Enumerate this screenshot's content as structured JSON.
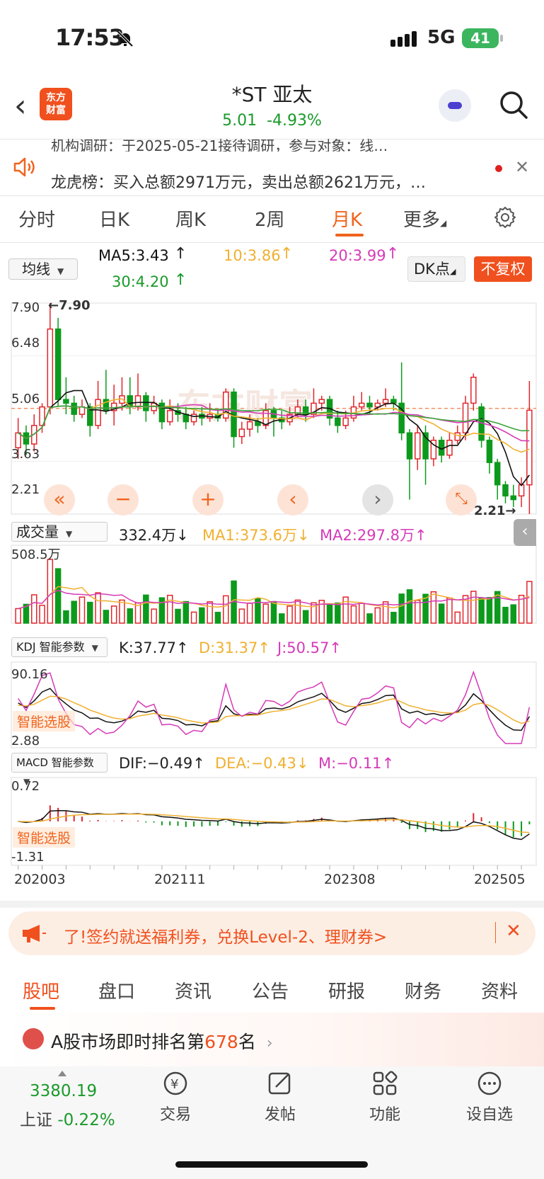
{
  "status_bar": {
    "time": "17:53",
    "network": "5G",
    "battery": "41"
  },
  "header": {
    "back_icon": "chevron-left-icon",
    "logo_line1": "东方",
    "logo_line2": "财富",
    "stock_name": "*ST 亚太",
    "price": "5.01",
    "change_pct": "-4.93%"
  },
  "ticker": {
    "prev_line": "机构调研：于2025-05-21接待调研，参与对象：线…",
    "main_line": "龙虎榜：买入总额2971万元，卖出总额2621万元，…"
  },
  "period_tabs": [
    "分时",
    "日K",
    "周K",
    "2周",
    "月K",
    "更多"
  ],
  "active_period": "月K",
  "ma_row": {
    "select_label": "均线",
    "ma5": "MA5:3.43",
    "ma10": "10:3.86",
    "ma20": "20:3.99",
    "ma30": "30:4.20",
    "dk_label": "DK点",
    "fq_label": "不复权"
  },
  "colors": {
    "up": "#e0262c",
    "down": "#0c9a1c",
    "ma5": "#111111",
    "ma10": "#f0b030",
    "ma20": "#d63ab8",
    "ma30": "#3aa53a",
    "accent": "#f0641e"
  },
  "main_chart": {
    "y_labels": [
      "7.90",
      "6.48",
      "5.06",
      "3.63",
      "2.21"
    ],
    "high_mark": "←7.90",
    "low_mark": "2.21→"
  },
  "volume": {
    "select_label": "成交量",
    "value": "332.4万",
    "ma1": "MA1:373.6万",
    "ma2": "MA2:297.8万",
    "max_label": "508.5万"
  },
  "kdj": {
    "select_label": "KDJ 智能参数",
    "k": "K:37.77",
    "d": "D:31.37",
    "j": "J:50.57",
    "top_label": "90.16",
    "bottom_label": "2.88",
    "smart_pick": "智能选股"
  },
  "macd": {
    "select_label": "MACD 智能参数",
    "dif": "DIF:−0.49",
    "dea": "DEA:−0.43",
    "m": "M:−0.11",
    "top_label": "0.72",
    "bottom_label": "-1.31",
    "smart_pick": "智能选股"
  },
  "x_dates": [
    "202003",
    "202111",
    "202308",
    "202505"
  ],
  "chart_data": {
    "type": "candlestick",
    "title": "*ST 亚太 月K",
    "ylim": [
      2.21,
      7.9
    ],
    "ma_values": {
      "MA5": 3.43,
      "MA10": 3.86,
      "MA20": 3.99,
      "MA30": 4.2
    },
    "candles": [
      [
        4.0,
        4.4,
        4.8,
        3.7
      ],
      [
        4.4,
        4.1,
        4.6,
        3.8
      ],
      [
        4.1,
        4.6,
        4.9,
        3.9
      ],
      [
        4.6,
        5.1,
        5.2,
        4.4
      ],
      [
        5.1,
        7.2,
        7.9,
        4.9
      ],
      [
        7.2,
        5.3,
        7.5,
        5.1
      ],
      [
        5.3,
        5.2,
        5.9,
        4.9
      ],
      [
        5.2,
        4.9,
        5.4,
        4.7
      ],
      [
        4.9,
        5.1,
        5.3,
        4.8
      ],
      [
        5.1,
        4.6,
        5.2,
        4.3
      ],
      [
        4.6,
        5.3,
        5.8,
        4.5
      ],
      [
        5.3,
        5.0,
        6.1,
        4.9
      ],
      [
        5.0,
        5.2,
        5.7,
        4.6
      ],
      [
        5.2,
        5.4,
        5.9,
        5.0
      ],
      [
        5.4,
        5.1,
        5.9,
        4.9
      ],
      [
        5.1,
        5.4,
        6.0,
        5.0
      ],
      [
        5.4,
        5.0,
        5.5,
        4.7
      ],
      [
        5.0,
        5.2,
        5.4,
        4.9
      ],
      [
        5.2,
        4.7,
        5.3,
        4.5
      ],
      [
        4.7,
        5.0,
        5.3,
        4.6
      ],
      [
        5.0,
        4.9,
        5.2,
        4.7
      ],
      [
        4.9,
        4.7,
        5.1,
        4.5
      ],
      [
        4.7,
        4.9,
        5.0,
        4.6
      ],
      [
        4.9,
        4.8,
        5.1,
        4.6
      ],
      [
        4.8,
        4.9,
        5.2,
        4.7
      ],
      [
        4.9,
        4.8,
        5.0,
        4.7
      ],
      [
        4.8,
        5.5,
        5.6,
        4.7
      ],
      [
        5.5,
        4.3,
        5.6,
        4.0
      ],
      [
        4.3,
        4.5,
        4.7,
        4.1
      ],
      [
        4.5,
        4.7,
        4.9,
        4.3
      ],
      [
        4.7,
        4.6,
        4.8,
        4.4
      ],
      [
        4.6,
        5.0,
        5.2,
        4.5
      ],
      [
        5.0,
        4.8,
        5.1,
        4.3
      ],
      [
        4.8,
        4.7,
        5.0,
        4.5
      ],
      [
        4.7,
        4.9,
        5.1,
        4.6
      ],
      [
        4.9,
        5.1,
        5.3,
        4.8
      ],
      [
        5.1,
        4.9,
        5.3,
        4.7
      ],
      [
        4.9,
        5.2,
        5.6,
        4.8
      ],
      [
        5.2,
        5.3,
        5.4,
        5.0
      ],
      [
        5.3,
        4.8,
        5.4,
        4.6
      ],
      [
        4.8,
        4.6,
        5.0,
        4.4
      ],
      [
        4.6,
        4.8,
        5.0,
        4.5
      ],
      [
        4.8,
        5.1,
        5.4,
        4.7
      ],
      [
        5.1,
        5.2,
        5.5,
        5.0
      ],
      [
        5.2,
        5.1,
        5.4,
        4.9
      ],
      [
        5.1,
        5.2,
        5.3,
        5.0
      ],
      [
        5.2,
        5.3,
        5.6,
        5.1
      ],
      [
        5.3,
        5.2,
        5.4,
        5.0
      ],
      [
        5.2,
        4.4,
        6.3,
        4.2
      ],
      [
        4.4,
        3.7,
        4.5,
        2.6
      ],
      [
        3.7,
        4.4,
        4.6,
        3.4
      ],
      [
        4.4,
        3.7,
        4.6,
        3.0
      ],
      [
        3.7,
        4.2,
        4.3,
        3.5
      ],
      [
        4.2,
        3.8,
        4.3,
        3.6
      ],
      [
        3.8,
        4.2,
        4.4,
        3.7
      ],
      [
        4.2,
        4.4,
        4.6,
        4.1
      ],
      [
        4.4,
        5.2,
        5.4,
        4.2
      ],
      [
        5.2,
        5.9,
        6.0,
        5.0
      ],
      [
        5.1,
        4.2,
        5.2,
        4.0
      ],
      [
        4.2,
        3.6,
        4.3,
        3.3
      ],
      [
        3.6,
        3.0,
        3.7,
        2.6
      ],
      [
        3.0,
        2.7,
        3.1,
        2.5
      ],
      [
        2.7,
        2.6,
        3.0,
        2.4
      ],
      [
        2.7,
        3.0,
        3.2,
        2.4
      ],
      [
        3.0,
        5.01,
        5.8,
        2.21
      ]
    ],
    "volume_max": 508.5,
    "volume_latest": 332.4
  },
  "banner": {
    "icon": "megaphone-icon",
    "text": "了!签约就送福利券，兑换Level-2、理财券>"
  },
  "bottom_tabs": [
    "股吧",
    "盘口",
    "资讯",
    "公告",
    "研报",
    "财务",
    "资料"
  ],
  "rank": {
    "prefix": "A股市场即时排名第",
    "num": "678",
    "suffix": "名"
  },
  "bottom_nav": {
    "index_value": "3380.19",
    "index_name": "上证",
    "index_change": "-0.22%",
    "items": [
      "交易",
      "发帖",
      "功能",
      "设自选"
    ]
  }
}
